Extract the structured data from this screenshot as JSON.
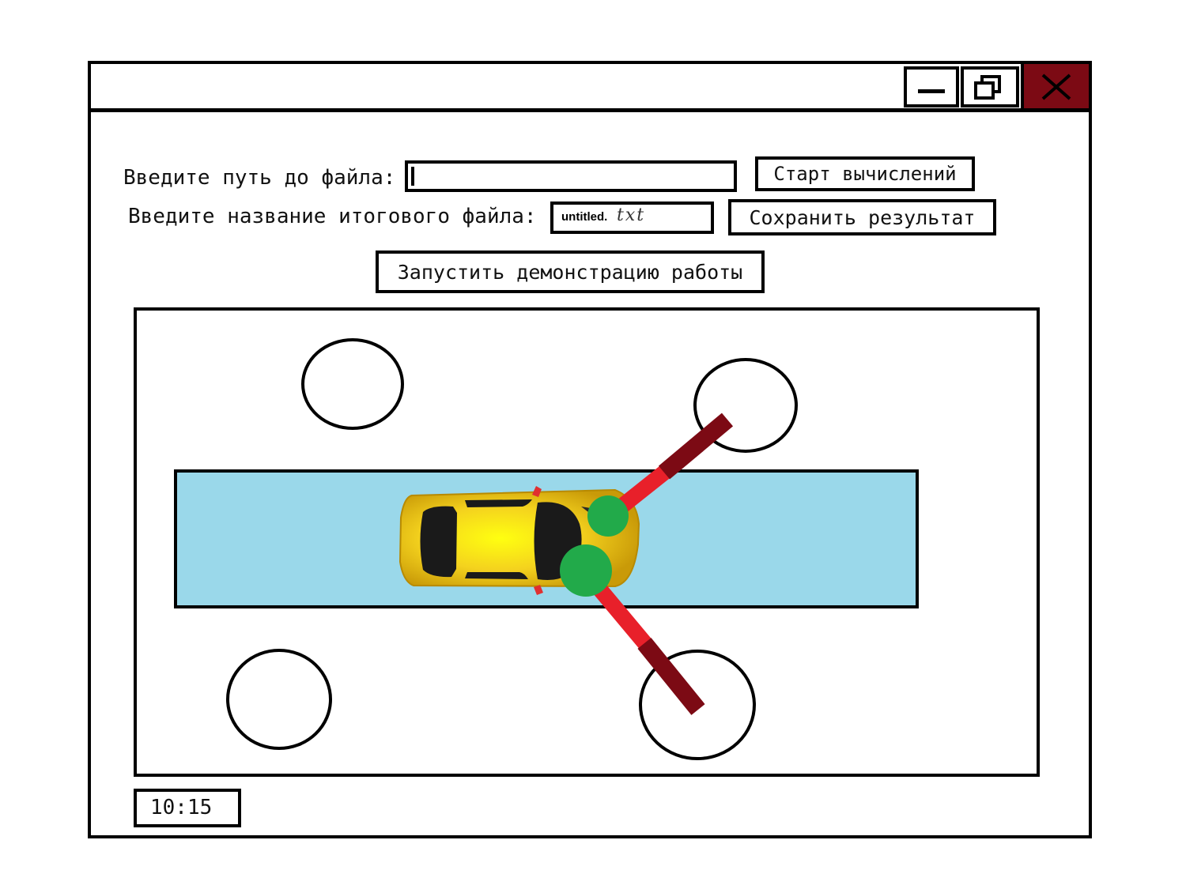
{
  "window": {
    "title": "",
    "controls": {
      "minimize": "minimize",
      "restore": "restore",
      "close": "close"
    }
  },
  "form": {
    "file_path_label": "Введите путь до файла:",
    "file_path_value": "",
    "start_button": "Старт вычислений",
    "output_name_label": "Введите название итогового файла:",
    "output_name_value": "untitled.",
    "output_name_ext": "txt",
    "save_button": "Сохранить результат",
    "demo_button": "Запустить демонстрацию работы"
  },
  "scene": {
    "track_color": "#9ad8ea",
    "sensor_color": "#22aa4a",
    "arm_color_inner": "#e8202a",
    "arm_color_outer": "#7c0a14",
    "obstacle_count": 4,
    "car_color": "#f2cf1a"
  },
  "status": {
    "time": "10:15"
  },
  "colors": {
    "close_button": "#7c0a14"
  }
}
